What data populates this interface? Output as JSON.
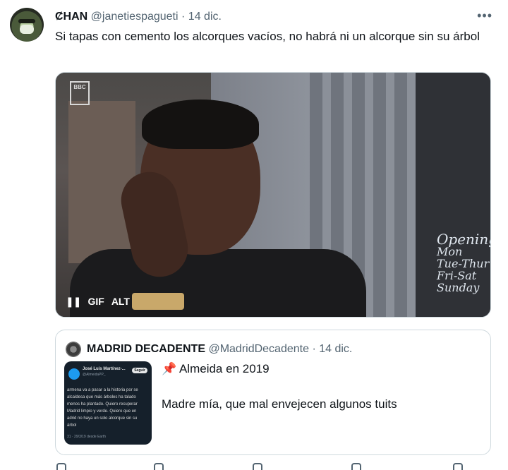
{
  "tweet": {
    "author_name": "ȻHAN",
    "author_handle": "@janetiespagueti",
    "separator": "·",
    "date": "14 dic.",
    "text": "Si tapas con cemento los alcorques vacíos, no habrá ni un alcorque sin su árbol",
    "more_icon": "more-horizontal-icon"
  },
  "media": {
    "type": "gif",
    "pause_label": "❚❚",
    "gif_badge": "GIF",
    "alt_badge": "ALT",
    "watermark": "BBC",
    "sign_lines": [
      "Opening",
      "Mon",
      "Tue-Thur",
      "Fri-Sat",
      "Sunday"
    ]
  },
  "quote": {
    "author_name": "MADRID DECADENTE",
    "author_handle": "@MadridDecadente",
    "separator": "·",
    "date": "14 dic.",
    "line1_emoji": "📌",
    "line1_text": "Almeida en 2019",
    "line2": "Madre mía, que mal envejecen algunos tuits",
    "thumbnail": {
      "name": "José Luis Martínez-...",
      "handle": "@AlmeidaPP_",
      "follow": "Seguir",
      "body": "armena va a pasar a la historia por se\n alcaldesa que más árboles ha talado\nmenos ha plantado. Quiero recuperar\n Madrid limpio y verde. Quiero que en\nadrid no haya un solo alcorque sin su\nárbol",
      "meta": "31 · 29/3/19 desde Earth"
    }
  },
  "actions": [
    "reply-icon",
    "retweet-icon",
    "like-icon",
    "views-icon",
    "share-icon"
  ]
}
